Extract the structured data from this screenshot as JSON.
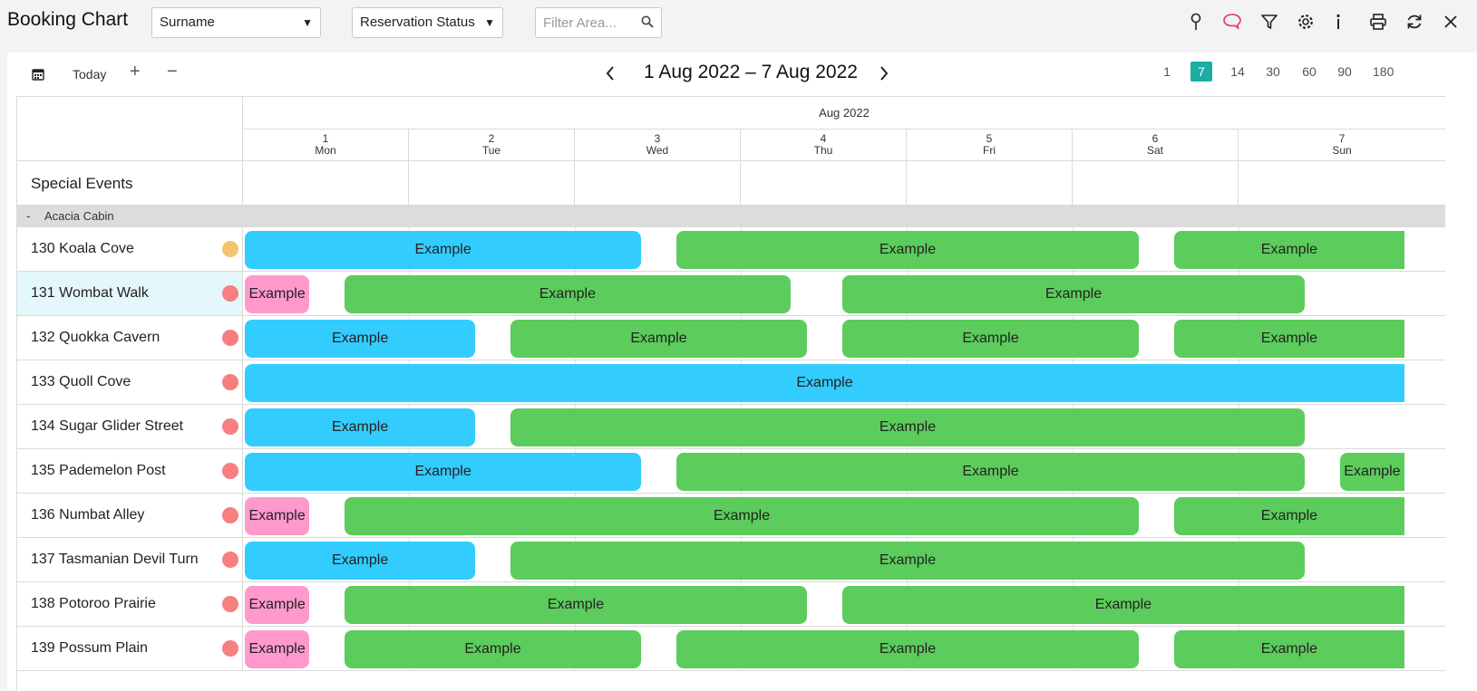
{
  "app": {
    "title": "Booking Chart"
  },
  "toolbar": {
    "sort_select": "Surname",
    "status_select": "Reservation Status",
    "filter_placeholder": "Filter Area...",
    "icons": [
      "map-pin-icon",
      "comment-icon",
      "filter-icon",
      "settings-icon",
      "info-icon",
      "print-icon",
      "refresh-icon",
      "close-icon"
    ]
  },
  "nav": {
    "today_label": "Today",
    "plus_label": "+",
    "minus_label": "−",
    "range_label": "1 Aug 2022 – 7 Aug 2022",
    "zoom_options": [
      "1",
      "7",
      "14",
      "30",
      "60",
      "90",
      "180"
    ],
    "zoom_selected": "7"
  },
  "calendar": {
    "month_label": "Aug 2022",
    "days": [
      {
        "num": "1",
        "name": "Mon"
      },
      {
        "num": "2",
        "name": "Tue"
      },
      {
        "num": "3",
        "name": "Wed"
      },
      {
        "num": "4",
        "name": "Thu"
      },
      {
        "num": "5",
        "name": "Fri"
      },
      {
        "num": "6",
        "name": "Sat"
      },
      {
        "num": "7",
        "name": "Sun"
      }
    ]
  },
  "special_events_label": "Special Events",
  "group": {
    "collapse_label": "-",
    "name": "Acacia Cabin"
  },
  "colors": {
    "blue": "#33ccff",
    "green": "#5ccc5c",
    "pink": "#ff99cc",
    "dot_yellow": "#f2c46d",
    "dot_red": "#f77f7f",
    "zoom_active": "#1aaea5"
  },
  "rows": [
    {
      "label": "130 Koala Cove",
      "dot": "yellow",
      "highlight": false,
      "bookings": [
        {
          "start": 1.0,
          "end": 3.4,
          "color": "blue",
          "text": "Example"
        },
        {
          "start": 3.6,
          "end": 6.4,
          "color": "green",
          "text": "Example"
        },
        {
          "start": 6.6,
          "end": 8.0,
          "color": "green",
          "text": "Example",
          "open_end": true
        }
      ]
    },
    {
      "label": "131 Wombat Walk",
      "dot": "red",
      "highlight": true,
      "bookings": [
        {
          "start": 1.0,
          "end": 1.4,
          "color": "pink",
          "text": "Example"
        },
        {
          "start": 1.6,
          "end": 4.3,
          "color": "green",
          "text": "Example"
        },
        {
          "start": 4.6,
          "end": 7.4,
          "color": "green",
          "text": "Example"
        }
      ]
    },
    {
      "label": "132 Quokka Cavern",
      "dot": "red",
      "highlight": false,
      "bookings": [
        {
          "start": 1.0,
          "end": 2.4,
          "color": "blue",
          "text": "Example"
        },
        {
          "start": 2.6,
          "end": 4.4,
          "color": "green",
          "text": "Example"
        },
        {
          "start": 4.6,
          "end": 6.4,
          "color": "green",
          "text": "Example"
        },
        {
          "start": 6.6,
          "end": 8.0,
          "color": "green",
          "text": "Example",
          "open_end": true
        }
      ]
    },
    {
      "label": "133 Quoll Cove",
      "dot": "red",
      "highlight": false,
      "bookings": [
        {
          "start": 1.0,
          "end": 8.0,
          "color": "blue",
          "text": "Example",
          "open_end": true
        }
      ]
    },
    {
      "label": "134 Sugar Glider Street",
      "dot": "red",
      "highlight": false,
      "bookings": [
        {
          "start": 1.0,
          "end": 2.4,
          "color": "blue",
          "text": "Example"
        },
        {
          "start": 2.6,
          "end": 7.4,
          "color": "green",
          "text": "Example"
        }
      ]
    },
    {
      "label": "135 Pademelon Post",
      "dot": "red",
      "highlight": false,
      "bookings": [
        {
          "start": 1.0,
          "end": 3.4,
          "color": "blue",
          "text": "Example"
        },
        {
          "start": 3.6,
          "end": 7.4,
          "color": "green",
          "text": "Example"
        },
        {
          "start": 7.6,
          "end": 8.0,
          "color": "green",
          "text": "Example",
          "open_end": true
        }
      ]
    },
    {
      "label": "136 Numbat Alley",
      "dot": "red",
      "highlight": false,
      "bookings": [
        {
          "start": 1.0,
          "end": 1.4,
          "color": "pink",
          "text": "Example"
        },
        {
          "start": 1.6,
          "end": 6.4,
          "color": "green",
          "text": "Example"
        },
        {
          "start": 6.6,
          "end": 8.0,
          "color": "green",
          "text": "Example",
          "open_end": true
        }
      ]
    },
    {
      "label": "137 Tasmanian Devil Turn",
      "dot": "red",
      "highlight": false,
      "bookings": [
        {
          "start": 1.0,
          "end": 2.4,
          "color": "blue",
          "text": "Example"
        },
        {
          "start": 2.6,
          "end": 7.4,
          "color": "green",
          "text": "Example"
        }
      ]
    },
    {
      "label": "138 Potoroo Prairie",
      "dot": "red",
      "highlight": false,
      "bookings": [
        {
          "start": 1.0,
          "end": 1.4,
          "color": "pink",
          "text": "Example"
        },
        {
          "start": 1.6,
          "end": 4.4,
          "color": "green",
          "text": "Example"
        },
        {
          "start": 4.6,
          "end": 8.0,
          "color": "green",
          "text": "Example",
          "open_end": true
        }
      ]
    },
    {
      "label": "139 Possum Plain",
      "dot": "red",
      "highlight": false,
      "bookings": [
        {
          "start": 1.0,
          "end": 1.4,
          "color": "pink",
          "text": "Example"
        },
        {
          "start": 1.6,
          "end": 3.4,
          "color": "green",
          "text": "Example"
        },
        {
          "start": 3.6,
          "end": 6.4,
          "color": "green",
          "text": "Example"
        },
        {
          "start": 6.6,
          "end": 8.0,
          "color": "green",
          "text": "Example",
          "open_end": true
        }
      ]
    }
  ]
}
